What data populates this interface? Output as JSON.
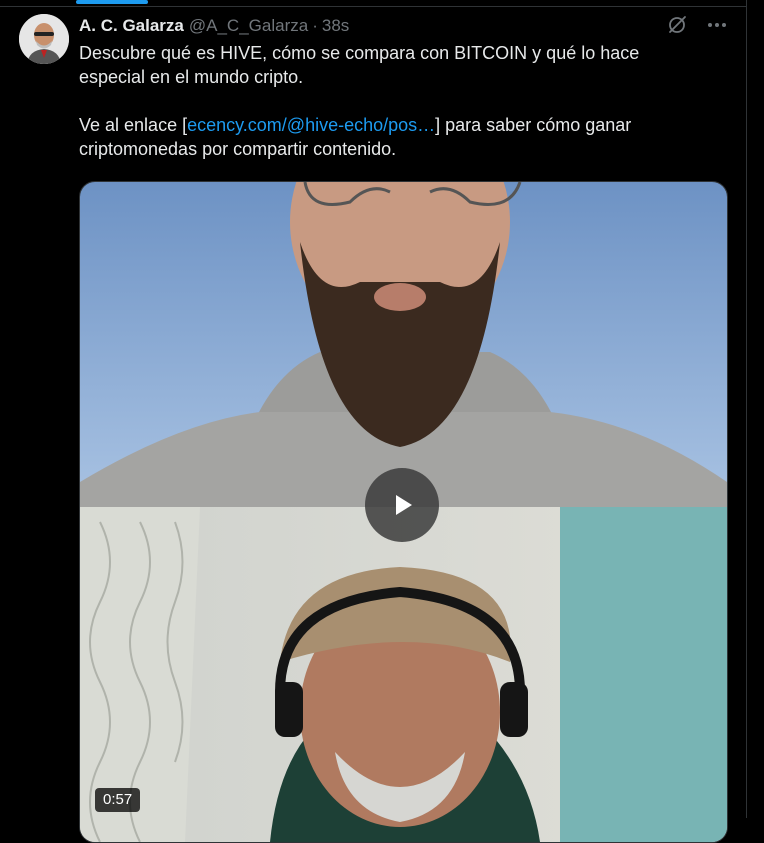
{
  "tweet": {
    "author_name": "A. C. Galarza",
    "author_handle": "@A_C_Galarza",
    "separator": "·",
    "timestamp": "38s",
    "paragraph_1": "Descubre qué es HIVE, cómo se compara con BITCOIN y qué lo hace especial en el mundo cripto.",
    "paragraph_2_prefix": "Ve al enlace [",
    "link_text": "ecency.com/@hive-echo/pos…",
    "paragraph_2_suffix": "] para saber cómo ganar criptomonedas por compartir contenido.",
    "video_duration": "0:57"
  },
  "icons": {
    "grok": "grok-icon",
    "more": "more-options-icon",
    "play": "play-icon"
  },
  "colors": {
    "background": "#000000",
    "text": "#e7e9ea",
    "secondary_text": "#71767b",
    "link": "#1d9bf0",
    "accent": "#1d9bf0"
  }
}
